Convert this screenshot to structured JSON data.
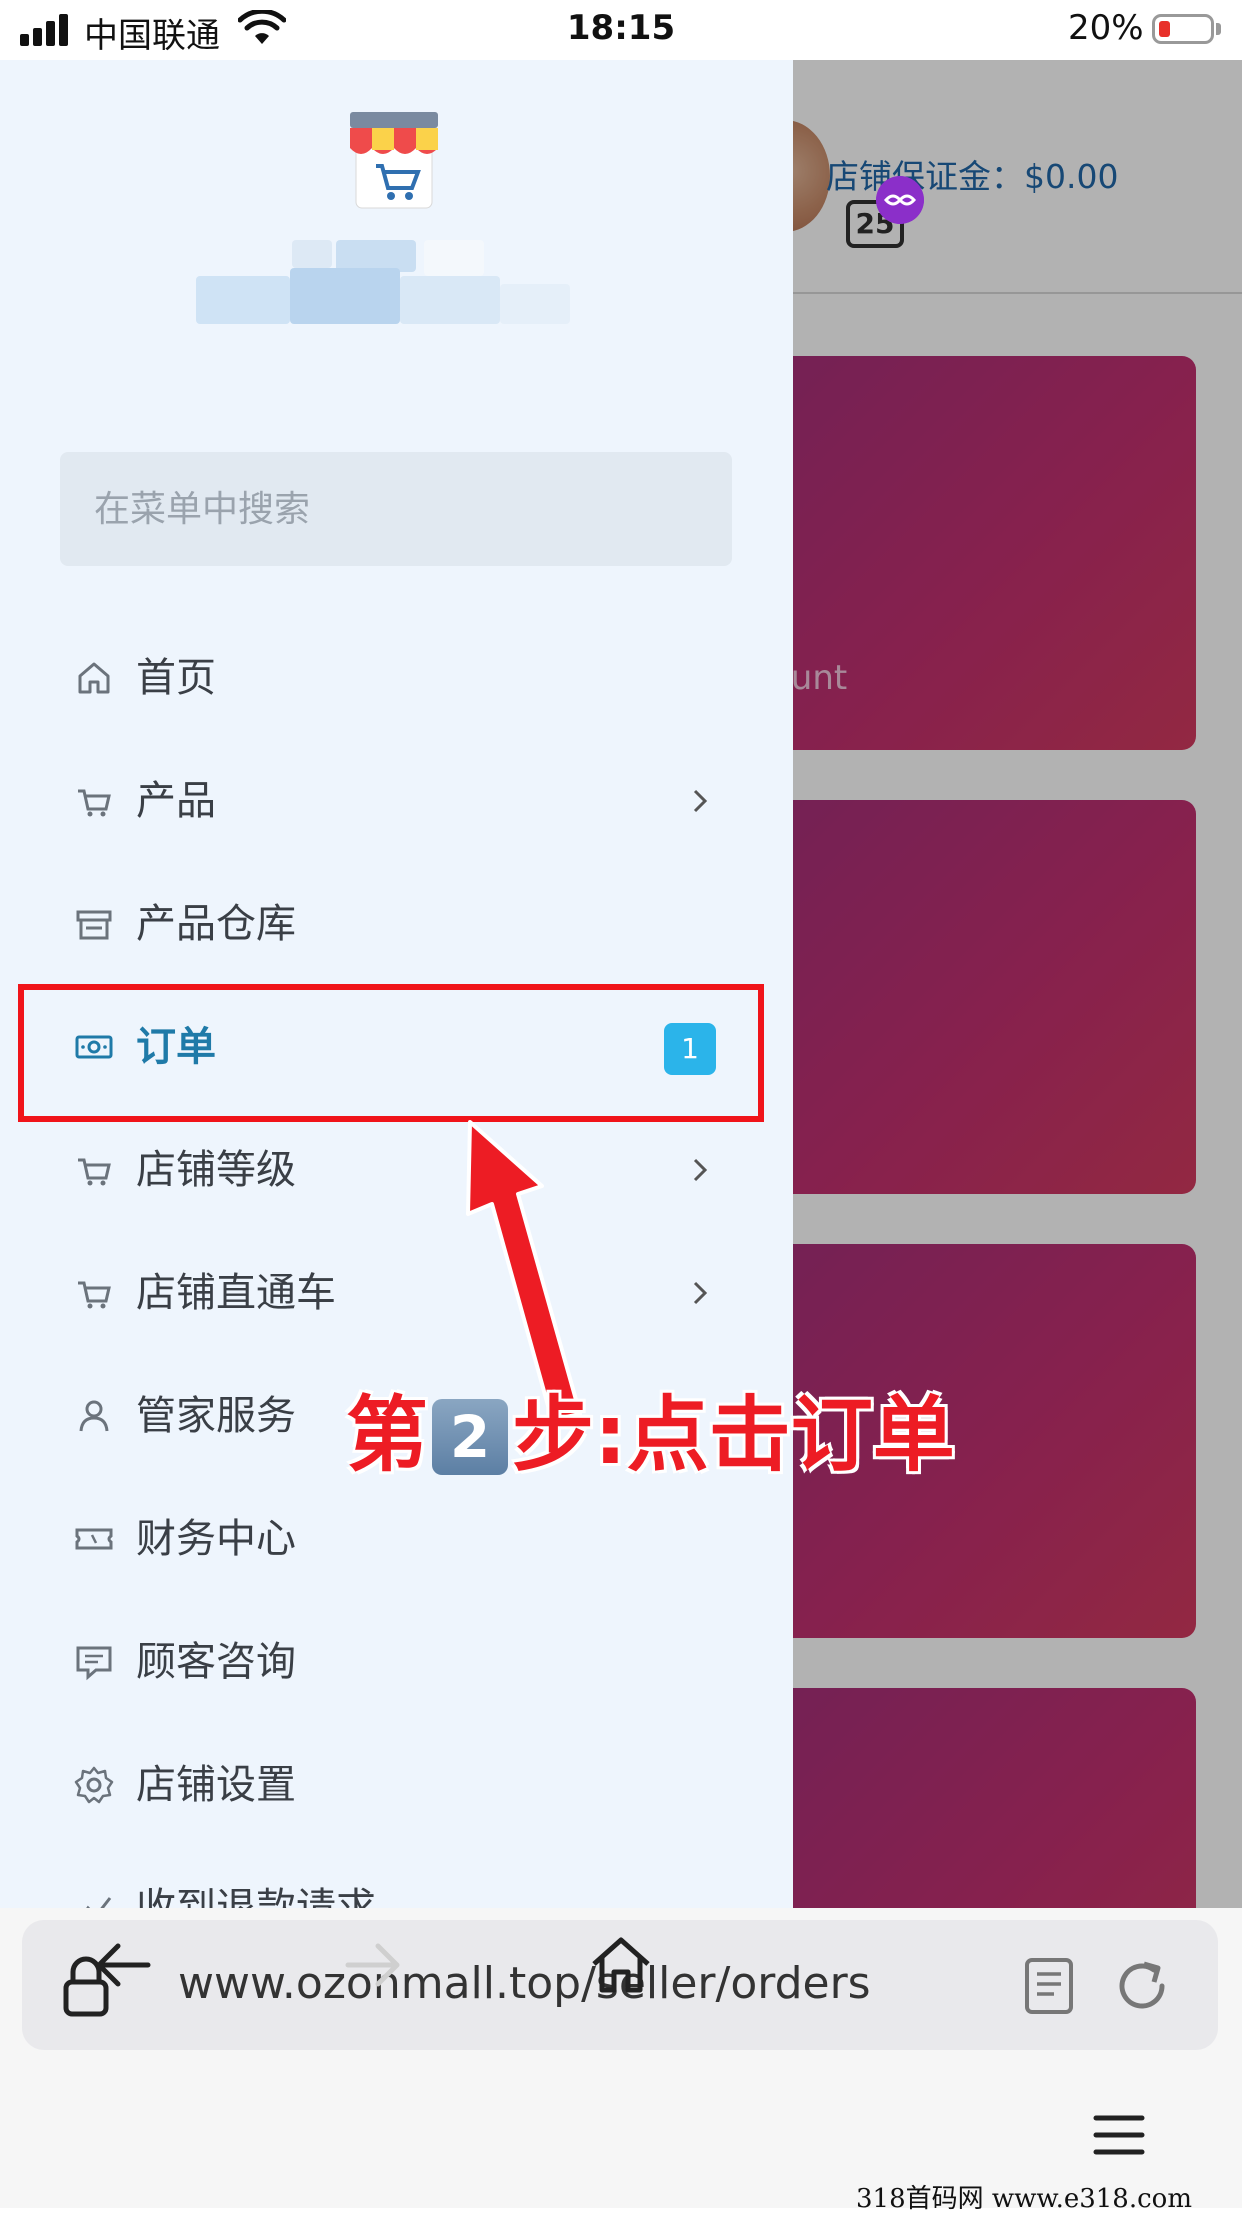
{
  "status_bar": {
    "carrier": "中国联通",
    "time": "18:15",
    "battery_percent": "20%"
  },
  "background_page": {
    "deposit_label": "店铺保证金：$0.00",
    "card_partial_text": "ount"
  },
  "drawer": {
    "search_placeholder": "在菜单中搜索",
    "menu": [
      {
        "label": "首页",
        "icon": "home-icon",
        "has_chevron": false
      },
      {
        "label": "产品",
        "icon": "cart-icon",
        "has_chevron": true
      },
      {
        "label": "产品仓库",
        "icon": "store-icon",
        "has_chevron": false
      },
      {
        "label": "订单",
        "icon": "money-icon",
        "has_chevron": false,
        "active": true,
        "badge": "1"
      },
      {
        "label": "店铺等级",
        "icon": "cart-icon",
        "has_chevron": true
      },
      {
        "label": "店铺直通车",
        "icon": "cart-icon",
        "has_chevron": true
      },
      {
        "label": "管家服务",
        "icon": "user-icon",
        "has_chevron": false
      },
      {
        "label": "财务中心",
        "icon": "ticket-icon",
        "has_chevron": false
      },
      {
        "label": "顾客咨询",
        "icon": "message-icon",
        "has_chevron": false
      },
      {
        "label": "店铺设置",
        "icon": "gear-icon",
        "has_chevron": false
      },
      {
        "label": "收到退款请求",
        "icon": "refund-icon",
        "has_chevron": false
      }
    ]
  },
  "annotation": {
    "step_prefix": "第",
    "step_number": "2",
    "step_suffix": "步:点击订单"
  },
  "browser": {
    "url": "www.ozonmall.top/seller/orders",
    "tabs_count": "25"
  },
  "watermark": "318首码网  www.e318.com",
  "colors": {
    "drawer_bg": "#eef5fd",
    "active_text": "#1f7aa8",
    "badge_bg": "#2bb4ea",
    "annotation_red": "#ed1c24",
    "card_gradient": "#b8307a"
  }
}
